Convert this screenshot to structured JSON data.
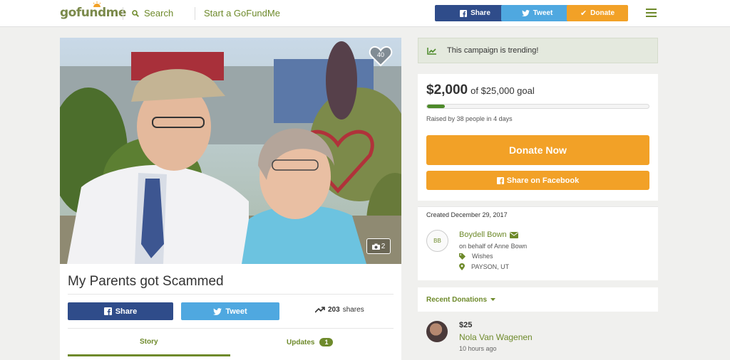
{
  "header": {
    "logo_text": "gofundme",
    "search_label": "Search",
    "start_label": "Start a GoFundMe",
    "share_label": "Share",
    "tweet_label": "Tweet",
    "donate_label": "Donate"
  },
  "hero": {
    "heart_count": "40",
    "photo_count": "2"
  },
  "campaign": {
    "title": "My Parents got Scammed",
    "share_label": "Share",
    "tweet_label": "Tweet",
    "shares_count": "203",
    "shares_word": "shares",
    "tabs": [
      {
        "label": "Story"
      },
      {
        "label": "Updates",
        "badge": "1"
      }
    ]
  },
  "trending": {
    "text": "This campaign is trending!"
  },
  "funding": {
    "raised_amount": "$2,000",
    "goal_text": "of $25,000 goal",
    "progress_fraction": 0.08,
    "raised_by_text": "Raised by 38 people in 4 days",
    "donate_now_label": "Donate Now",
    "share_facebook_label": "Share on Facebook"
  },
  "organizer": {
    "created_text": "Created December 29, 2017",
    "initials": "BB",
    "name": "Boydell Bown",
    "behalf_text": "on behalf of Anne Bown",
    "category": "Wishes",
    "location": "PAYSON, UT"
  },
  "recent_donations": {
    "header": "Recent Donations",
    "items": [
      {
        "amount": "$25",
        "name": "Nola Van Wagenen",
        "time": "10 hours ago"
      }
    ]
  },
  "colors": {
    "brand_green": "#6e8a2b",
    "facebook_blue": "#2f4c8a",
    "twitter_blue": "#4fa8e0",
    "donate_orange": "#f2a127",
    "progress_green": "#4d8a2a"
  }
}
